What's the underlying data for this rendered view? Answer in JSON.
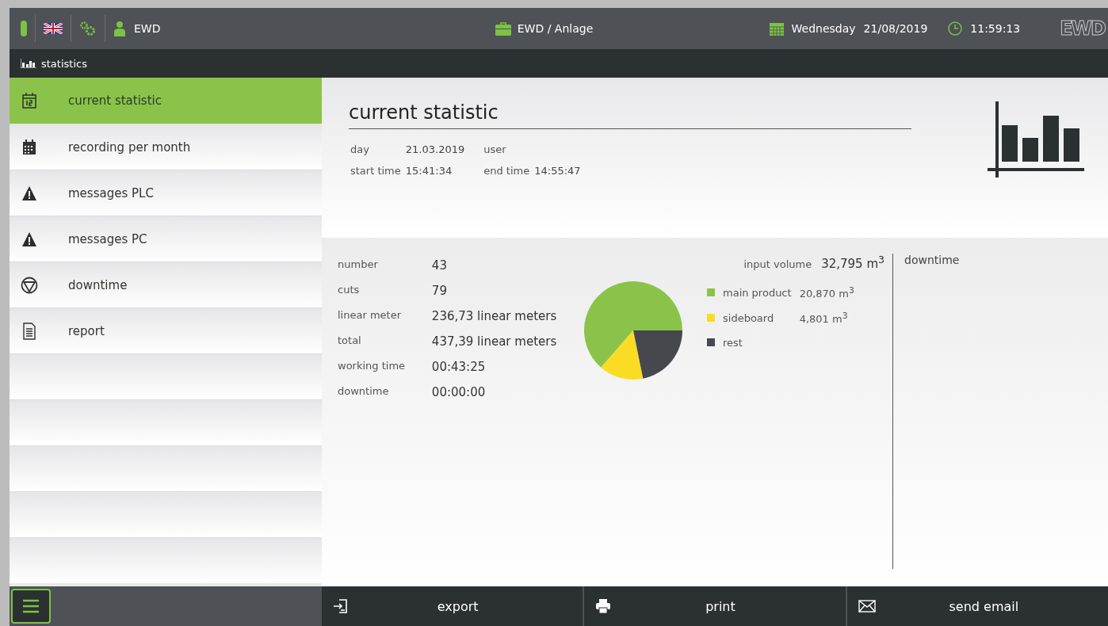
{
  "header": {
    "user": "EWD",
    "location": "EWD / Anlage",
    "weekday": "Wednesday",
    "date": "21/08/2019",
    "time": "11:59:13",
    "logo": "EWD"
  },
  "breadcrumb": "statistics",
  "sidebar": {
    "items": [
      {
        "label": "current statistic",
        "selected": true
      },
      {
        "label": "recording per month",
        "selected": false
      },
      {
        "label": "messages PLC",
        "selected": false
      },
      {
        "label": "messages PC",
        "selected": false
      },
      {
        "label": "downtime",
        "selected": false
      },
      {
        "label": "report",
        "selected": false
      }
    ]
  },
  "summary": {
    "title": "current statistic",
    "fields": [
      {
        "label": "day",
        "value": "21.03.2019"
      },
      {
        "label": "user"
      },
      {
        "label": "start time",
        "value": "15:41:34"
      },
      {
        "label": "end time",
        "value": "14:55:47"
      }
    ]
  },
  "metrics": [
    {
      "label": "number",
      "value": "43"
    },
    {
      "label": "cuts",
      "value": "79"
    },
    {
      "label": "linear meter",
      "value": "236,73 linear meters"
    },
    {
      "label": "total",
      "value": "437,39 linear meters"
    },
    {
      "label": "working time",
      "value": "00:43:25"
    },
    {
      "label": "downtime",
      "value": "00:00:00"
    }
  ],
  "volume": {
    "label": "input volume",
    "value": "32,795 m$^{3}$",
    "chart_data": {
      "type": "pie",
      "categories": [
        "main product",
        "sideboard",
        "rest"
      ],
      "series": [
        {
          "values": [
            63.6,
            14.6,
            21.8
          ]
        }
      ]
    },
    "legend": [
      {
        "value": "20,870 m$^{3}$",
        "color": "#8bc34a"
      },
      {
        "value": "4,801 m$^{3}$",
        "color": "#fbdc24"
      },
      {
        "color": "#45484d"
      }
    ]
  },
  "downtime_panel": {
    "title": "downtime"
  },
  "footer": {
    "buttons": [
      {
        "label": "export"
      },
      {
        "label": "print"
      },
      {
        "label": "send email"
      }
    ]
  }
}
